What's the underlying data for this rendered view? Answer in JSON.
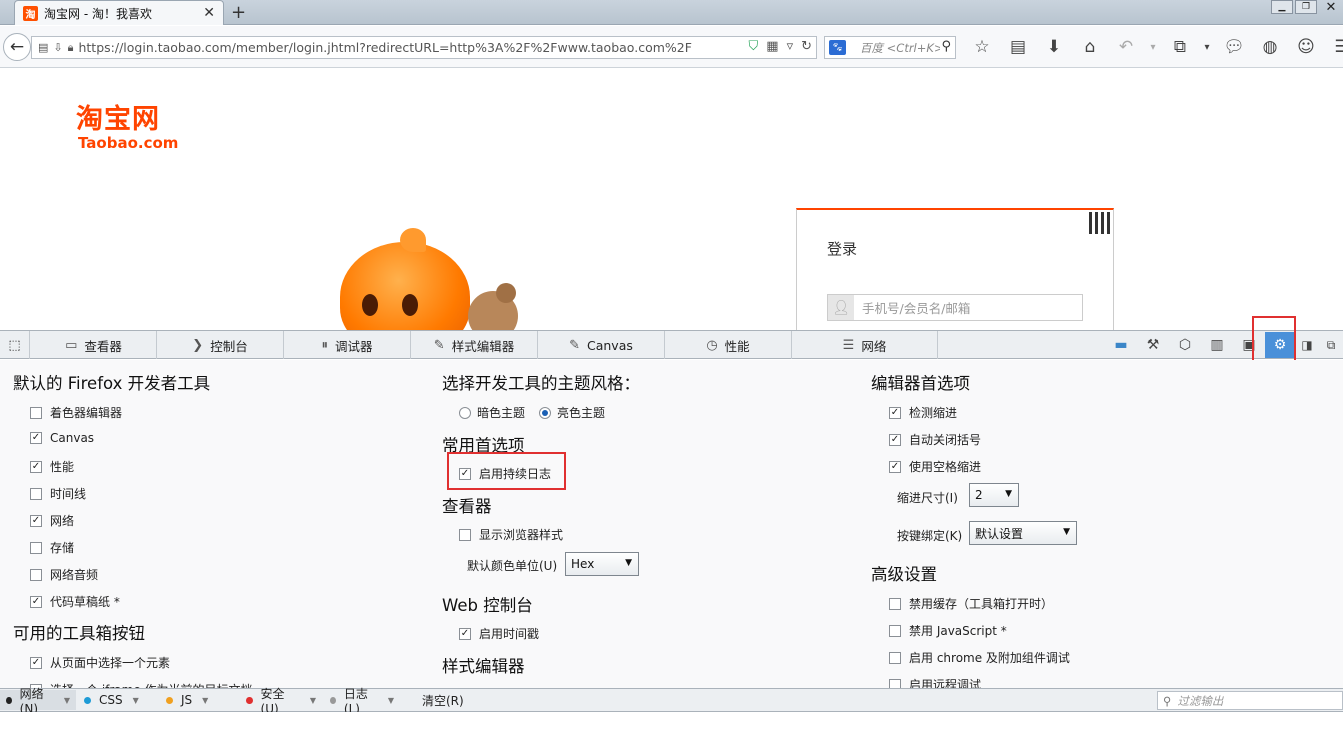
{
  "browser": {
    "tab_title": "淘宝网 - 淘！我喜欢",
    "tab_favicon": "淘",
    "url": "https://login.taobao.com/member/login.jhtml?redirectURL=http%3A%2F%2Fwww.taobao.com%2F",
    "search_placeholder": "百度 <Ctrl+K>",
    "search_engine": "baidu-paw",
    "toolbar_icons": [
      "bookmark-star-icon",
      "reading-list-icon",
      "download-icon",
      "home-icon",
      "undo-icon",
      "crop-icon",
      "chat-icon",
      "globe-icon",
      "smiley-icon",
      "menu-icon"
    ]
  },
  "page": {
    "logo_cn": "淘宝网",
    "logo_en": "Taobao.com",
    "login_title": "登录",
    "login_placeholder": "手机号/会员名/邮箱"
  },
  "devtools": {
    "tabs": [
      {
        "label": "查看器",
        "icon": "inspector-icon",
        "glyph": "▭"
      },
      {
        "label": "控制台",
        "icon": "console-icon",
        "glyph": "❯"
      },
      {
        "label": "调试器",
        "icon": "debugger-icon",
        "glyph": "⏸"
      },
      {
        "label": "样式编辑器",
        "icon": "style-editor-icon",
        "glyph": "✎"
      },
      {
        "label": "Canvas",
        "icon": "canvas-icon",
        "glyph": "✎"
      },
      {
        "label": "性能",
        "icon": "performance-icon",
        "glyph": "◷"
      },
      {
        "label": "网络",
        "icon": "network-icon",
        "glyph": "☰"
      }
    ],
    "options": {
      "col1": {
        "heading": "默认的 Firefox 开发者工具",
        "items": [
          {
            "label": "着色器编辑器",
            "checked": false
          },
          {
            "label": "Canvas",
            "checked": true
          },
          {
            "label": "性能",
            "checked": true
          },
          {
            "label": "时间线",
            "checked": false
          },
          {
            "label": "网络",
            "checked": true
          },
          {
            "label": "存储",
            "checked": false
          },
          {
            "label": "网络音频",
            "checked": false
          },
          {
            "label": "代码草稿纸 *",
            "checked": true
          }
        ],
        "heading2": "可用的工具箱按钮",
        "items2": [
          {
            "label": "从页面中选择一个元素",
            "checked": true
          },
          {
            "label": "选择一个 iframe 作为当前的目标文档",
            "checked": false
          }
        ]
      },
      "col2": {
        "theme_heading": "选择开发工具的主题风格：",
        "theme_dark": "暗色主题",
        "theme_light": "亮色主题",
        "theme_selected": "light",
        "common_heading": "常用首选项",
        "persist_logs": "启用持续日志",
        "persist_checked": true,
        "inspector_heading": "查看器",
        "show_browser_styles": "显示浏览器样式",
        "show_browser_checked": false,
        "color_unit_label": "默认颜色单位(U)",
        "color_unit_value": "Hex",
        "console_heading": "Web 控制台",
        "timestamps": "启用时间戳",
        "timestamps_checked": true,
        "style_editor_heading": "样式编辑器"
      },
      "col3": {
        "editor_heading": "编辑器首选项",
        "items": [
          {
            "label": "检测缩进",
            "checked": true
          },
          {
            "label": "自动关闭括号",
            "checked": true
          },
          {
            "label": "使用空格缩进",
            "checked": true
          }
        ],
        "indent_label": "缩进尺寸(I)",
        "indent_value": "2",
        "keybinding_label": "按键绑定(K)",
        "keybinding_value": "默认设置",
        "advanced_heading": "高级设置",
        "advanced_items": [
          {
            "label": "禁用缓存（工具箱打开时）",
            "checked": false
          },
          {
            "label": "禁用 JavaScript *",
            "checked": false
          },
          {
            "label": "启用 chrome 及附加组件调试",
            "checked": false
          },
          {
            "label": "启用远程调试",
            "checked": false
          }
        ]
      }
    },
    "console": {
      "filters": [
        {
          "label": "网络(N)",
          "color": "#222222"
        },
        {
          "label": "CSS",
          "color": "#1e9bd6"
        },
        {
          "label": "JS",
          "color": "#f0a020"
        },
        {
          "label": "安全(U)",
          "color": "#e03030"
        },
        {
          "label": "日志(L)",
          "color": "#999999"
        }
      ],
      "clear": "清空(R)",
      "filter_placeholder": "过滤输出"
    }
  },
  "colors": {
    "highlight": "#e03030",
    "active_tab": "#4a90d9",
    "brand": "#ff4400"
  }
}
